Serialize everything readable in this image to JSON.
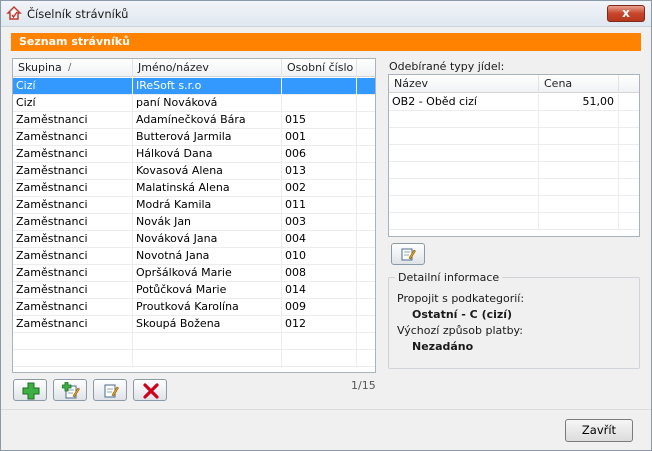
{
  "window": {
    "title": "Číselník strávníků",
    "close_glyph": "x"
  },
  "section_title": "Seznam strávníků",
  "main_table": {
    "headers": [
      "Skupina",
      "Jméno/název",
      "Osobní číslo"
    ],
    "rows": [
      [
        "Cizí",
        "IReSoft s.r.o",
        ""
      ],
      [
        "Cizí",
        "paní Nováková",
        ""
      ],
      [
        "Zaměstnanci",
        "Adamínečková Bára",
        "015"
      ],
      [
        "Zaměstnanci",
        "Butterová Jarmila",
        "001"
      ],
      [
        "Zaměstnanci",
        "Hálková Dana",
        "006"
      ],
      [
        "Zaměstnanci",
        "Kovasová Alena",
        "013"
      ],
      [
        "Zaměstnanci",
        "Malatinská Alena",
        "002"
      ],
      [
        "Zaměstnanci",
        "Modrá Kamila",
        "011"
      ],
      [
        "Zaměstnanci",
        "Novák Jan",
        "003"
      ],
      [
        "Zaměstnanci",
        "Nováková Jana",
        "004"
      ],
      [
        "Zaměstnanci",
        "Novotná Jana",
        "010"
      ],
      [
        "Zaměstnanci",
        "Opršálková Marie",
        "008"
      ],
      [
        "Zaměstnanci",
        "Potůčková Marie",
        "014"
      ],
      [
        "Zaměstnanci",
        "Proutková Karolína",
        "009"
      ],
      [
        "Zaměstnanci",
        "Skoupá Božena",
        "012"
      ]
    ],
    "selected_index": 0,
    "counter": "1/15"
  },
  "meal_types": {
    "label": "Odebírané typy jídel:",
    "headers": [
      "Název",
      "Cena"
    ],
    "rows": [
      [
        "OB2 - Oběd cizí",
        "51,00"
      ]
    ]
  },
  "detail": {
    "legend": "Detailní informace",
    "subcategory_label": "Propojit s podkategorií:",
    "subcategory_value": "Ostatní - C (cizí)",
    "payment_label": "Výchozí způsob platby:",
    "payment_value": "Nezadáno"
  },
  "toolbar": {
    "add": "add-icon",
    "add_copy": "add-copy-icon",
    "edit": "edit-icon",
    "delete": "delete-icon"
  },
  "footer": {
    "close_label": "Zavřít"
  },
  "colors": {
    "accent": "#ff8200",
    "selection": "#3399ff",
    "close": "#c8452a"
  }
}
